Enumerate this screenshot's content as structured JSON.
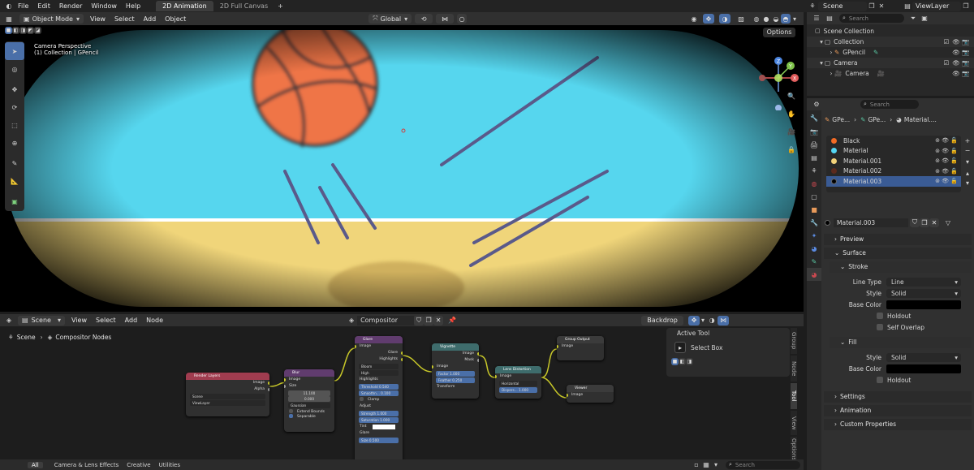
{
  "topbar": {
    "menus": [
      "File",
      "Edit",
      "Render",
      "Window",
      "Help"
    ],
    "workspaces": [
      "2D Animation",
      "2D Full Canvas"
    ],
    "scene": "Scene",
    "viewlayer": "ViewLayer"
  },
  "viewport": {
    "mode": "Object Mode",
    "menus": [
      "View",
      "Select",
      "Add",
      "Object"
    ],
    "orientation": "Global",
    "options": "Options",
    "overlay_line1": "Camera Perspective",
    "overlay_line2": "(1) Collection | GPencil",
    "gizmo": {
      "z": "Z",
      "y": "Y",
      "x": "X"
    }
  },
  "outliner": {
    "search_placeholder": "Search",
    "root": "Scene Collection",
    "items": [
      {
        "label": "Collection"
      },
      {
        "label": "GPencil"
      },
      {
        "label": "Camera"
      },
      {
        "label": "Camera"
      }
    ]
  },
  "properties": {
    "search_placeholder": "Search",
    "breadcrumb": [
      "GPe...",
      "GPe...",
      "Material...."
    ],
    "materials": [
      {
        "name": "Black",
        "color": "#f26b25"
      },
      {
        "name": "Material",
        "color": "#55d6f2"
      },
      {
        "name": "Material.001",
        "color": "#f2d27a"
      },
      {
        "name": "Material.002",
        "color": "#5b2a1e"
      },
      {
        "name": "Material.003",
        "color": "#000000"
      }
    ],
    "active_material": "Material.003",
    "panels": {
      "preview": "Preview",
      "surface": "Surface",
      "stroke": "Stroke",
      "fill": "Fill",
      "settings": "Settings",
      "animation": "Animation",
      "custom": "Custom Properties"
    },
    "stroke": {
      "line_type_label": "Line Type",
      "line_type": "Line",
      "style_label": "Style",
      "style": "Solid",
      "base_color_label": "Base Color",
      "holdout": "Holdout",
      "self_overlap": "Self Overlap"
    },
    "fill": {
      "style_label": "Style",
      "style": "Solid",
      "base_color_label": "Base Color",
      "holdout": "Holdout"
    }
  },
  "node_editor": {
    "scene": "Scene",
    "menus": [
      "View",
      "Select",
      "Add",
      "Node"
    ],
    "tree": "Compositor Nodes",
    "backdrop": "Backdrop",
    "breadcrumb": [
      "Scene",
      "Compositor Nodes"
    ],
    "sidebar_tabs": [
      "Group",
      "Node",
      "Tool",
      "View",
      "Options"
    ],
    "active_tool_title": "Active Tool",
    "active_tool": "Select Box",
    "footer_tabs": [
      "All",
      "Camera & Lens Effects",
      "Creative",
      "Utilities"
    ],
    "footer_search": "Search",
    "nodes": {
      "render_layers": {
        "title": "Render Layers",
        "out1": "Image",
        "out2": "Alpha",
        "scene": "Scene",
        "layer": "ViewLayer"
      },
      "blur": {
        "title": "Blur",
        "in1": "Image",
        "in2": "Size",
        "v1": "11.100",
        "v2": "0.000",
        "filter": "Gaussian",
        "extend": "Extend Bounds",
        "separable": "Separable"
      },
      "glare": {
        "title": "Glare",
        "in": "Image",
        "out1": "Glare",
        "out2": "Highlights",
        "type": "Bloom",
        "quality": "High",
        "sec1": "Highlights",
        "threshold": "Threshold 0.540",
        "smooth": "Smoothn... 0.100",
        "clamp": "Clamp",
        "sec2": "Adjust",
        "strength": "Strength 1.000",
        "saturation": "Saturation 1.000",
        "tint": "Tint",
        "sec3": "Glare",
        "size": "Size 0.500"
      },
      "vignette": {
        "title": "Vignette",
        "in": "Image",
        "out1": "Image",
        "out2": "Mask",
        "factor": "Factor 1.000",
        "feather": "Feather 0.250",
        "transform": "Transform"
      },
      "lens": {
        "title": "Lens Distortion",
        "in": "Image",
        "out": "Image",
        "type": "Horizontal",
        "dispersion": "Dispers... 1.000"
      },
      "group_output": {
        "title": "Group Output",
        "in": "Image"
      },
      "viewer": {
        "title": "Viewer",
        "in": "Image"
      }
    }
  }
}
